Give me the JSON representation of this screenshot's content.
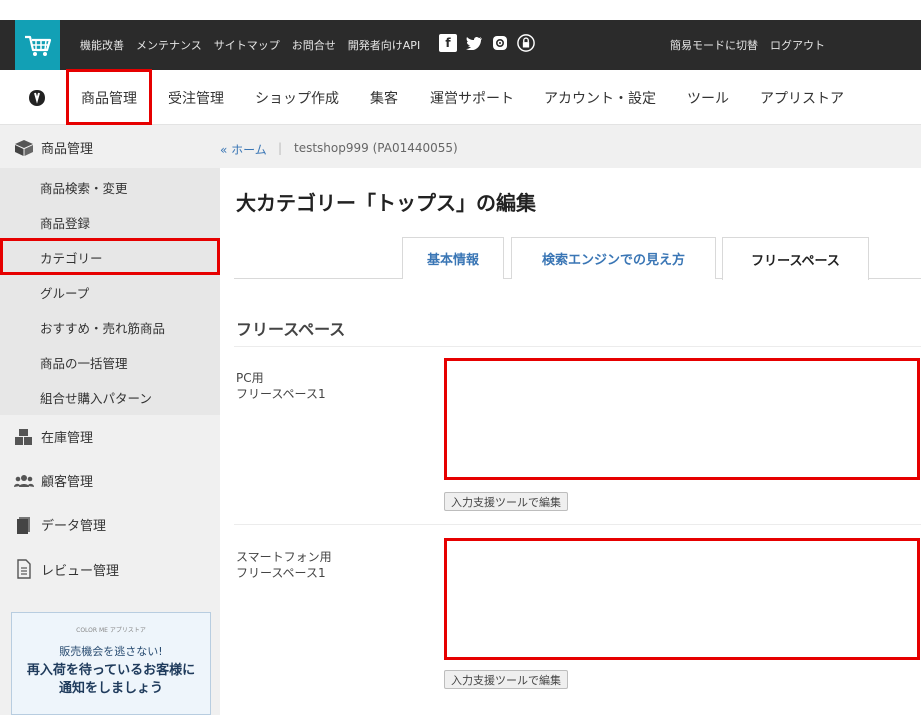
{
  "topbar": {
    "links": [
      "機能改善",
      "メンテナンス",
      "サイトマップ",
      "お問合せ",
      "開発者向けAPI"
    ],
    "right_links": [
      "簡易モードに切替",
      "ログアウト"
    ],
    "social": {
      "facebook": "f",
      "twitter": "t"
    }
  },
  "nav": {
    "items": [
      "商品管理",
      "受注管理",
      "ショップ作成",
      "集客",
      "運営サポート",
      "アカウント・設定",
      "ツール",
      "アプリストア"
    ]
  },
  "sidebar": {
    "product": "商品管理",
    "subitems": [
      "商品検索・変更",
      "商品登録",
      "カテゴリー",
      "グループ",
      "おすすめ・売れ筋商品",
      "商品の一括管理",
      "組合せ購入パターン"
    ],
    "inventory": "在庫管理",
    "customer": "顧客管理",
    "data": "データ管理",
    "review": "レビュー管理",
    "promo": {
      "brand": "COLOR ME アプリストア",
      "line1": "販売機会を逃さない!",
      "line2": "再入荷を待っているお客様に",
      "line3": "通知をしましょう"
    }
  },
  "breadcrumb": {
    "home": "« ホーム",
    "sep": "|",
    "shop": "testshop999 (PA01440055)"
  },
  "page": {
    "title": "大カテゴリー「トップス」の編集",
    "tabs": [
      "基本情報",
      "検索エンジンでの見え方",
      "フリースペース"
    ],
    "section_title": "フリースペース",
    "fields": [
      {
        "label1": "PC用",
        "label2": "フリースペース1",
        "value": "",
        "button": "入力支援ツールで編集"
      },
      {
        "label1": "スマートフォン用",
        "label2": "フリースペース1",
        "value": "",
        "button": "入力支援ツールで編集"
      }
    ]
  },
  "colors": {
    "highlight": "#e60000",
    "logo_bg": "#12a0b5",
    "topbar_bg": "#2b2b2b",
    "link": "#3a76b5"
  }
}
